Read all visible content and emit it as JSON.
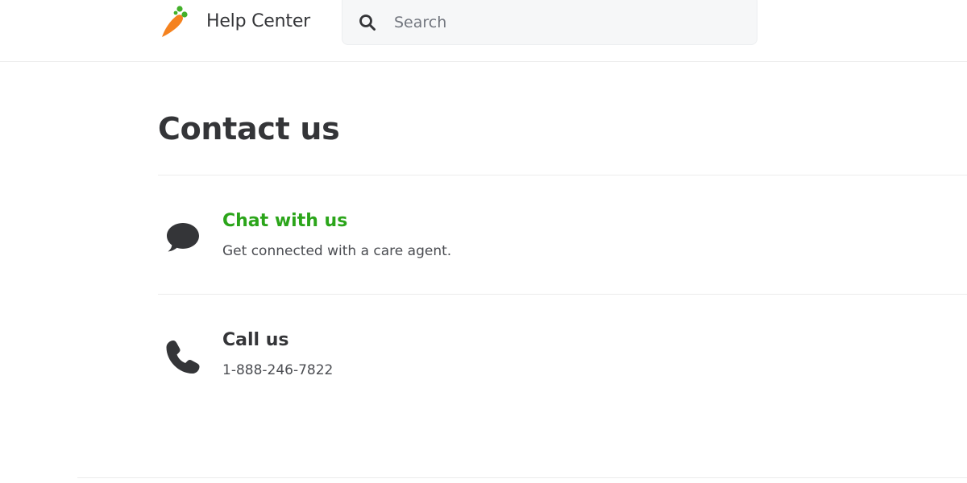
{
  "header": {
    "brand_title": "Help Center",
    "logo_icon": "carrot-logo-icon",
    "search": {
      "placeholder": "Search",
      "value": "",
      "icon": "search-icon"
    }
  },
  "main": {
    "page_title": "Contact us",
    "options": [
      {
        "title": "Chat with us",
        "description": "Get connected with a care agent.",
        "icon": "chat-bubble-icon"
      },
      {
        "title": "Call us",
        "description": "1-888-246-7822",
        "icon": "phone-icon"
      }
    ]
  },
  "colors": {
    "link_green": "#2ba51a",
    "text_dark": "#343538",
    "carrot_orange": "#f5821f",
    "leaf_green": "#43b02a"
  }
}
